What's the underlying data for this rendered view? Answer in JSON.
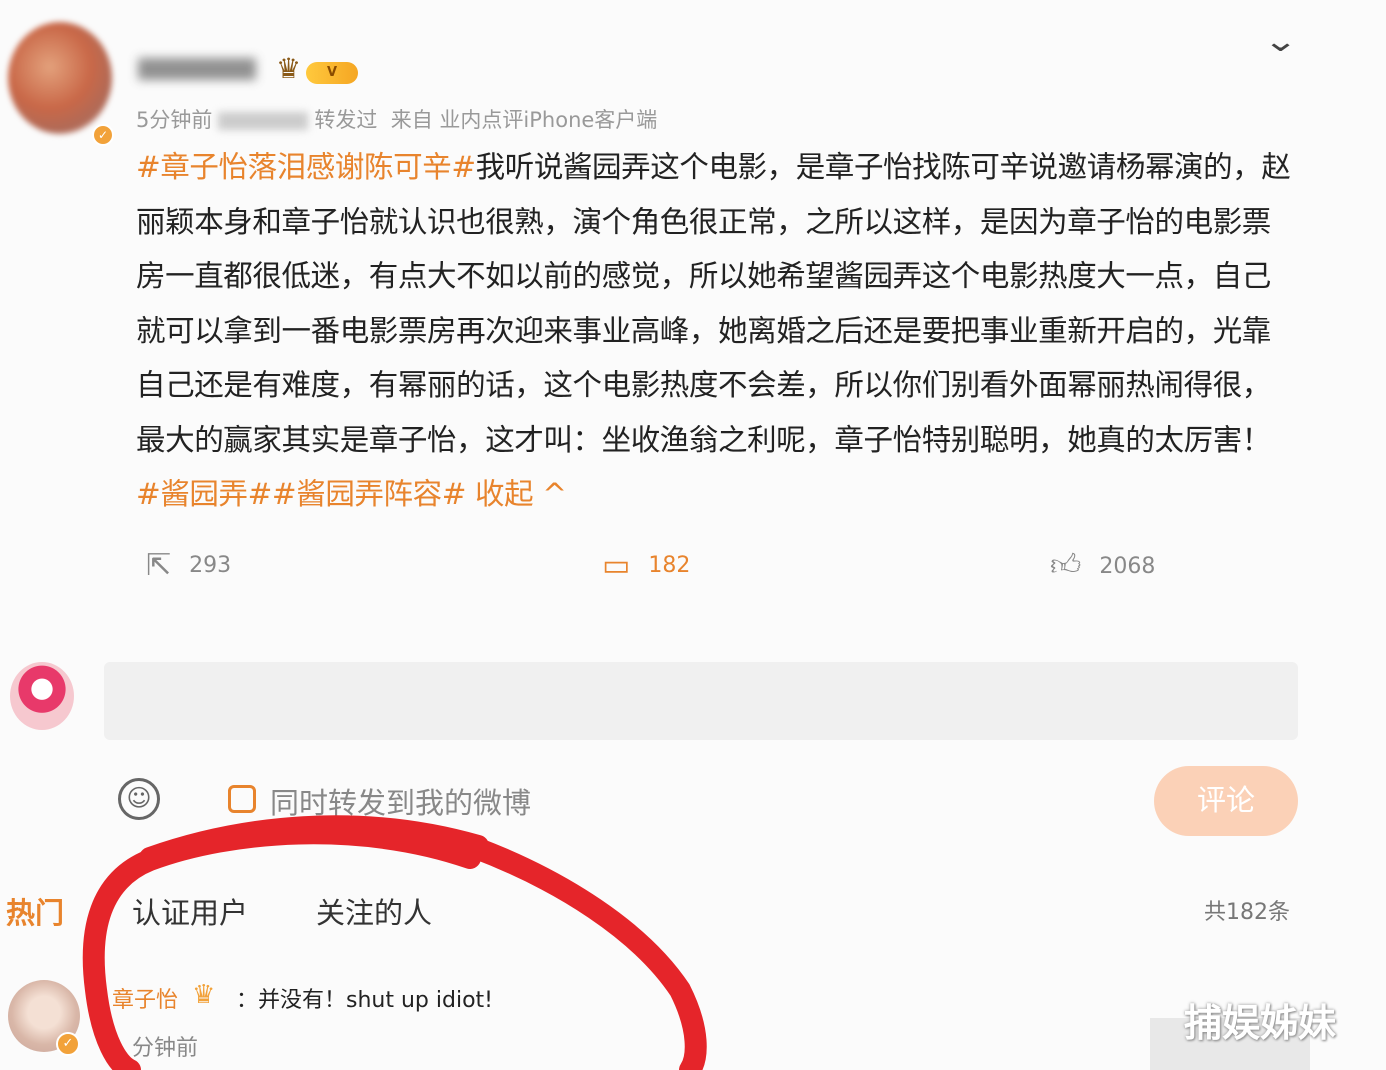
{
  "post": {
    "time": "5分钟前",
    "reposted": "转发过",
    "source": "来自 业内点评iPhone客户端",
    "vip_label": "V",
    "tag1": "#章子怡落泪感谢陈可辛#",
    "body1": "我听说酱园弄这个电影，是章子怡找陈可辛说邀请杨幂演的，赵丽颖本身和章子怡就认识也很熟，演个角色很正常，之所以这样，是因为章子怡的电影票房一直都很低迷，有点大不如以前的感觉，所以她希望酱园弄这个电影热度大一点，自己就可以拿到一番电影票房再次迎来事业高峰，她离婚之后还是要把事业重新开启的，光靠自己还是有难度，有幂丽的话，这个电影热度不会差，所以你们别看外面幂丽热闹得很，最大的赢家其实是章子怡，这才叫：坐收渔翁之利呢，章子怡特别聪明，她真的太厉害！",
    "tag2": "#酱园弄##酱园弄阵容#",
    "collapse": " 收起",
    "collapse_icon": "^"
  },
  "actions": {
    "repost_count": "293",
    "comment_count": "182",
    "like_count": "2068"
  },
  "composer": {
    "repost_checkbox_label": "同时转发到我的微博",
    "submit": "评论"
  },
  "comment_tabs": {
    "hot": "热门",
    "verified": "认证用户",
    "following": "关注的人",
    "total": "共182条"
  },
  "comment": {
    "author": "章子怡",
    "separator": "：",
    "text": "并没有！shut up idiot!",
    "time": "分钟前"
  },
  "watermark": "捕娱姊妹",
  "colors": {
    "accent": "#e8842d",
    "annotation": "#e5252a"
  }
}
